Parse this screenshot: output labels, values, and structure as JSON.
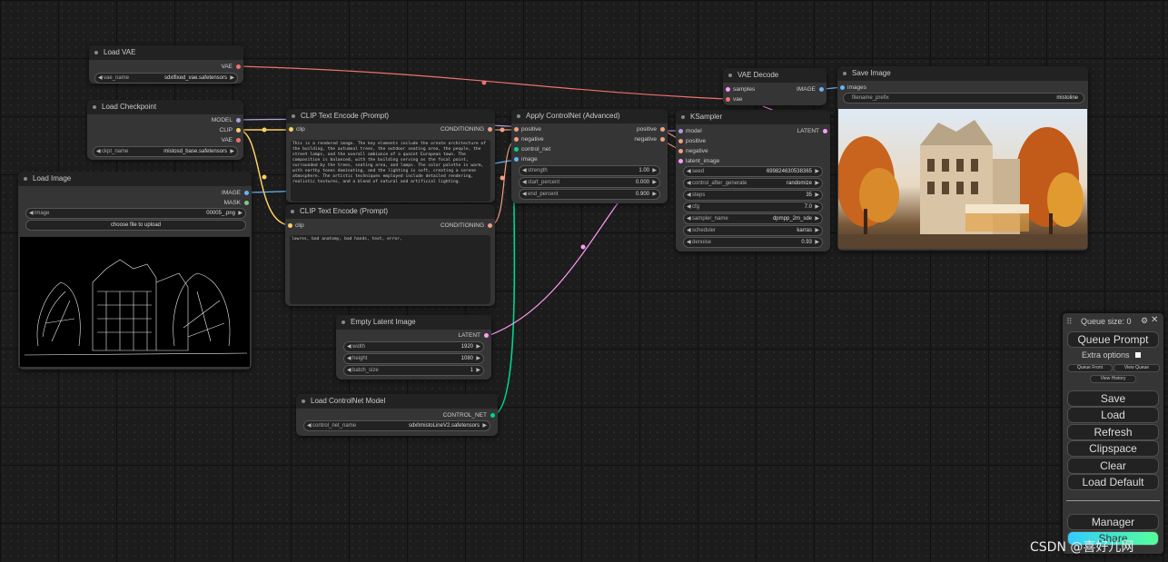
{
  "colors": {
    "vae": "#f07070",
    "clip": "#ffd064",
    "model": "#b39ddb",
    "conditioning": "#f0a080",
    "image": "#64b5f6",
    "latent": "#ff9cf9",
    "control_net": "#00d68a"
  },
  "nodes": {
    "load_vae": {
      "title": "Load VAE",
      "out": "VAE",
      "w_label": "vae_name",
      "w_value": "sdxlfixed_vae.safetensors"
    },
    "load_checkpoint": {
      "title": "Load Checkpoint",
      "out1": "MODEL",
      "out2": "CLIP",
      "out3": "VAE",
      "w_label": "ckpt_name",
      "w_value": "mistosd_base.safetensors"
    },
    "load_image": {
      "title": "Load Image",
      "out1": "IMAGE",
      "out2": "MASK",
      "w_label": "image",
      "w_value": "00005_.png",
      "upload": "choose file to upload"
    },
    "clip_pos": {
      "title": "CLIP Text Encode (Prompt)",
      "in": "clip",
      "out": "CONDITIONING",
      "text": "This is a rendered image. The key elements include the ornate architecture of the building, the autumnal trees, the outdoor seating area, the people, the street lamps, and the overall ambiance of a quaint European town. The composition is balanced, with the building serving as the focal point, surrounded by the trees, seating area, and lamps. The color palette is warm, with earthy tones dominating, and the lighting is soft, creating a serene atmosphere. The artistic techniques employed include detailed rendering, realistic textures, and a blend of natural and artificial lighting."
    },
    "clip_neg": {
      "title": "CLIP Text Encode (Prompt)",
      "in": "clip",
      "out": "CONDITIONING",
      "text": "lowres, bad anatomy, bad hands, text, error,"
    },
    "apply_cn": {
      "title": "Apply ControlNet (Advanced)",
      "in1": "positive",
      "in2": "negative",
      "in3": "control_net",
      "in4": "image",
      "out1": "positive",
      "out2": "negative",
      "widgets": [
        {
          "label": "strength",
          "value": "1.00"
        },
        {
          "label": "start_percent",
          "value": "0.000"
        },
        {
          "label": "end_percent",
          "value": "0.900"
        }
      ]
    },
    "ksampler": {
      "title": "KSampler",
      "in1": "model",
      "in2": "positive",
      "in3": "negative",
      "in4": "latent_image",
      "out": "LATENT",
      "widgets": [
        {
          "label": "seed",
          "value": "699824630538365"
        },
        {
          "label": "control_after_generate",
          "value": "randomize"
        },
        {
          "label": "steps",
          "value": "35"
        },
        {
          "label": "cfg",
          "value": "7.0"
        },
        {
          "label": "sampler_name",
          "value": "dpmpp_2m_sde"
        },
        {
          "label": "scheduler",
          "value": "karras"
        },
        {
          "label": "denoise",
          "value": "0.93"
        }
      ]
    },
    "vae_decode": {
      "title": "VAE Decode",
      "in1": "samples",
      "in2": "vae",
      "out": "IMAGE"
    },
    "save_image": {
      "title": "Save Image",
      "in": "images",
      "w_label": "filename_prefix",
      "w_value": "mistoline"
    },
    "empty_latent": {
      "title": "Empty Latent Image",
      "out": "LATENT",
      "widgets": [
        {
          "label": "width",
          "value": "1920"
        },
        {
          "label": "height",
          "value": "1080"
        },
        {
          "label": "batch_size",
          "value": "1"
        }
      ]
    },
    "load_cn": {
      "title": "Load ControlNet Model",
      "out": "CONTROL_NET",
      "w_label": "control_net_name",
      "w_value": "sdxl\\mistoLineV2.safetensors"
    }
  },
  "menu": {
    "queue_size": "Queue size: 0",
    "queue_prompt": "Queue Prompt",
    "extra_options": "Extra options",
    "queue_front": "Queue Front",
    "view_queue": "View Queue",
    "view_history": "View History",
    "buttons": [
      "Save",
      "Load",
      "Refresh",
      "Clipspace",
      "Clear",
      "Load Default"
    ],
    "manager": "Manager",
    "share": "Share"
  },
  "watermark": "CSDN @喜好儿网"
}
